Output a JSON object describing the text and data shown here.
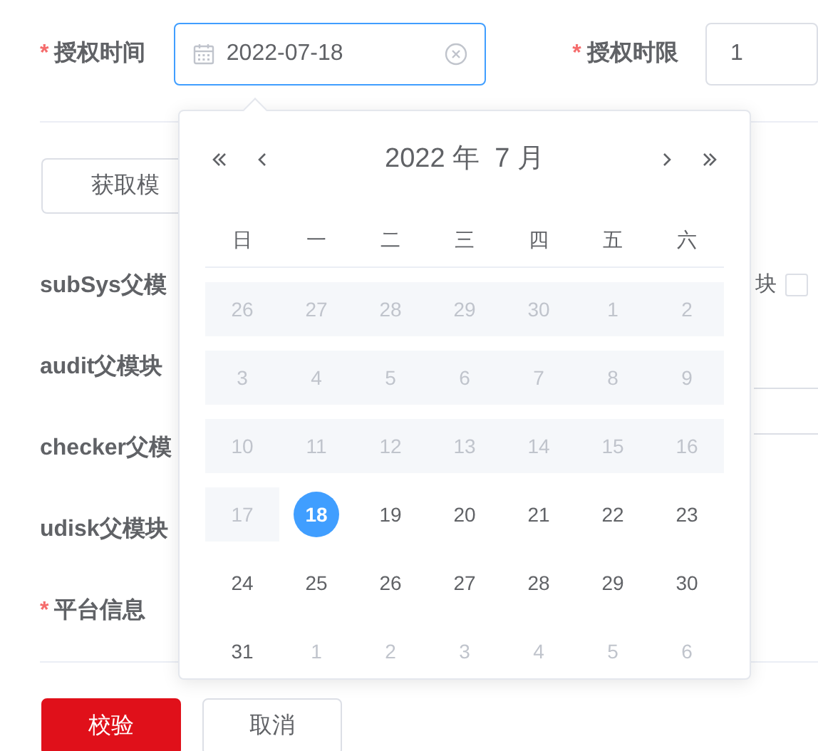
{
  "form": {
    "fields": [
      {
        "required_mark": "*",
        "label": "授权时间",
        "value": "2022-07-18",
        "focused": true
      },
      {
        "required_mark": "*",
        "label": "授权时限",
        "value": "1",
        "focused": false
      }
    ],
    "fetch_button": "获取模",
    "rows": [
      {
        "label": "subSys父模"
      },
      {
        "label": "audit父模块"
      },
      {
        "label": "checker父模"
      },
      {
        "label": "udisk父模块"
      },
      {
        "required_mark": "*",
        "label": "平台信息"
      }
    ],
    "side_label": "块",
    "side_checkbox": {
      "checked": false
    },
    "buttons": [
      {
        "label": "校验",
        "kind": "primary"
      },
      {
        "label": "取消",
        "kind": "default"
      }
    ]
  },
  "date_picker": {
    "title": "2022 年  7 月",
    "weekdays": [
      "日",
      "一",
      "二",
      "三",
      "四",
      "五",
      "六"
    ],
    "weeks": [
      [
        {
          "day": "26",
          "kind": "disabled",
          "selected": false
        },
        {
          "day": "27",
          "kind": "disabled",
          "selected": false
        },
        {
          "day": "28",
          "kind": "disabled",
          "selected": false
        },
        {
          "day": "29",
          "kind": "disabled",
          "selected": false
        },
        {
          "day": "30",
          "kind": "disabled",
          "selected": false
        },
        {
          "day": "1",
          "kind": "disabled",
          "selected": false
        },
        {
          "day": "2",
          "kind": "disabled",
          "selected": false
        }
      ],
      [
        {
          "day": "3",
          "kind": "disabled",
          "selected": false
        },
        {
          "day": "4",
          "kind": "disabled",
          "selected": false
        },
        {
          "day": "5",
          "kind": "disabled",
          "selected": false
        },
        {
          "day": "6",
          "kind": "disabled",
          "selected": false
        },
        {
          "day": "7",
          "kind": "disabled",
          "selected": false
        },
        {
          "day": "8",
          "kind": "disabled",
          "selected": false
        },
        {
          "day": "9",
          "kind": "disabled",
          "selected": false
        }
      ],
      [
        {
          "day": "10",
          "kind": "disabled",
          "selected": false
        },
        {
          "day": "11",
          "kind": "disabled",
          "selected": false
        },
        {
          "day": "12",
          "kind": "disabled",
          "selected": false
        },
        {
          "day": "13",
          "kind": "disabled",
          "selected": false
        },
        {
          "day": "14",
          "kind": "disabled",
          "selected": false
        },
        {
          "day": "15",
          "kind": "disabled",
          "selected": false
        },
        {
          "day": "16",
          "kind": "disabled",
          "selected": false
        }
      ],
      [
        {
          "day": "17",
          "kind": "disabled",
          "selected": false
        },
        {
          "day": "18",
          "kind": "current",
          "selected": true
        },
        {
          "day": "19",
          "kind": "current",
          "selected": false
        },
        {
          "day": "20",
          "kind": "current",
          "selected": false
        },
        {
          "day": "21",
          "kind": "current",
          "selected": false
        },
        {
          "day": "22",
          "kind": "current",
          "selected": false
        },
        {
          "day": "23",
          "kind": "current",
          "selected": false
        }
      ],
      [
        {
          "day": "24",
          "kind": "current",
          "selected": false
        },
        {
          "day": "25",
          "kind": "current",
          "selected": false
        },
        {
          "day": "26",
          "kind": "current",
          "selected": false
        },
        {
          "day": "27",
          "kind": "current",
          "selected": false
        },
        {
          "day": "28",
          "kind": "current",
          "selected": false
        },
        {
          "day": "29",
          "kind": "current",
          "selected": false
        },
        {
          "day": "30",
          "kind": "current",
          "selected": false
        }
      ],
      [
        {
          "day": "31",
          "kind": "current",
          "selected": false
        },
        {
          "day": "1",
          "kind": "other_month",
          "selected": false
        },
        {
          "day": "2",
          "kind": "other_month",
          "selected": false
        },
        {
          "day": "3",
          "kind": "other_month",
          "selected": false
        },
        {
          "day": "4",
          "kind": "other_month",
          "selected": false
        },
        {
          "day": "5",
          "kind": "other_month",
          "selected": false
        },
        {
          "day": "6",
          "kind": "other_month",
          "selected": false
        }
      ]
    ]
  }
}
